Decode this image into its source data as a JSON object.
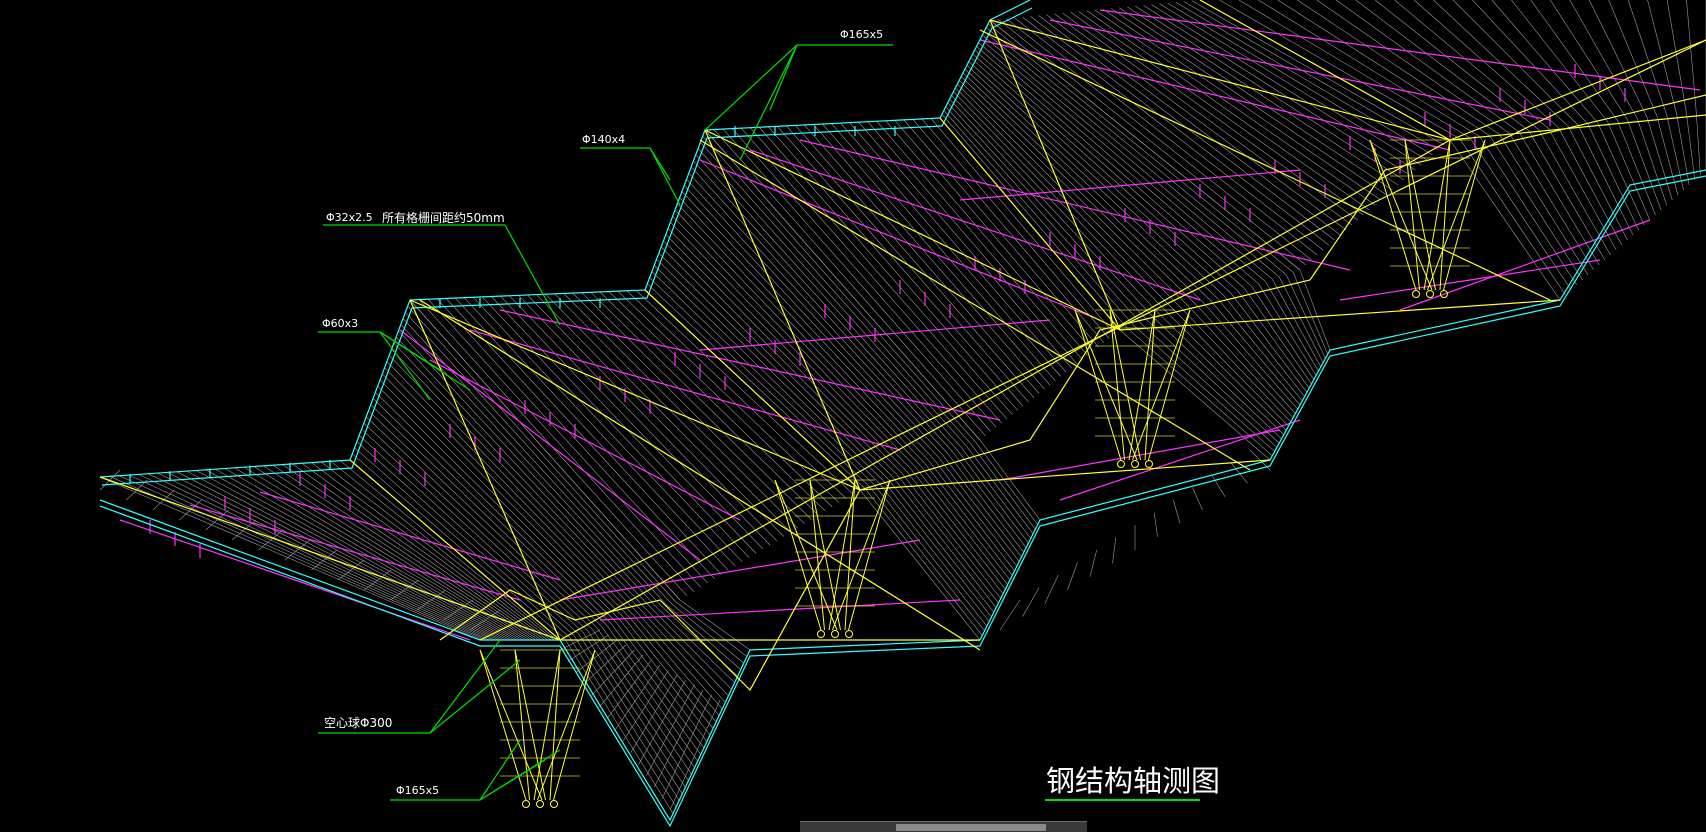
{
  "annotations": {
    "tube_165_top": "Φ165x5",
    "tube_140": "Φ140x4",
    "tube_32": "Φ32x2.5",
    "grille_spacing": "所有格栅间距约50mm",
    "tube_60": "Φ60x3",
    "hollow_ball": "空心球Φ300",
    "tube_165_bottom": "Φ165x5"
  },
  "drawing_title": "钢结构轴测图",
  "colors": {
    "background": "#000000",
    "frame_yellow": "#ffff33",
    "grille_magenta": "#ff33ff",
    "edge_cyan": "#33ffff",
    "leader_green": "#00dd00",
    "fill_lines": "#d0d0d0",
    "text": "#ffffff"
  }
}
